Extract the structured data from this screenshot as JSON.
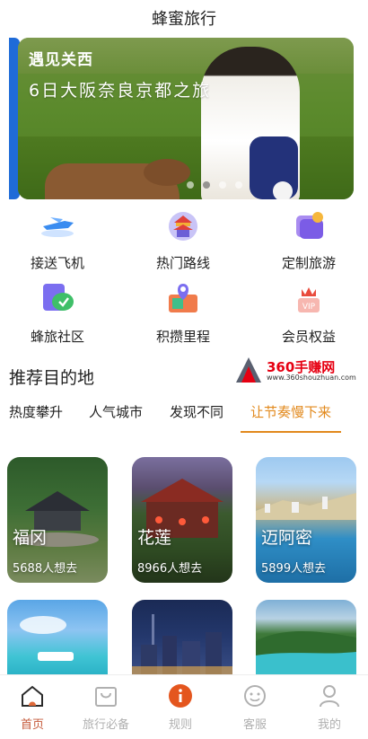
{
  "header": {
    "title": "蜂蜜旅行"
  },
  "banner": {
    "tag": "遇见关西",
    "title": "6日大阪奈良京都之旅"
  },
  "services": [
    {
      "label": "接送飞机",
      "icon": "plane-pickup-icon"
    },
    {
      "label": "热门路线",
      "icon": "temple-route-icon"
    },
    {
      "label": "定制旅游",
      "icon": "custom-tour-icon"
    },
    {
      "label": "蜂旅社区",
      "icon": "community-chat-icon"
    },
    {
      "label": "积攒里程",
      "icon": "mileage-map-icon"
    },
    {
      "label": "会员权益",
      "icon": "vip-crown-icon"
    }
  ],
  "section": {
    "title": "推荐目的地"
  },
  "watermark": {
    "text": "360手赚网",
    "url": "www.360shouzhuan.com"
  },
  "tabs": [
    {
      "label": "热度攀升",
      "active": false
    },
    {
      "label": "人气城市",
      "active": false
    },
    {
      "label": "发现不同",
      "active": false
    },
    {
      "label": "让节奏慢下来",
      "active": true
    }
  ],
  "destinations": [
    {
      "name": "福冈",
      "subtitle": "5688人想去"
    },
    {
      "name": "花莲",
      "subtitle": "8966人想去"
    },
    {
      "name": "迈阿密",
      "subtitle": "5899人想去"
    }
  ],
  "bottom_nav": [
    {
      "label": "首页",
      "icon": "home-icon",
      "active": true
    },
    {
      "label": "旅行必备",
      "icon": "bag-icon",
      "active": false
    },
    {
      "label": "规则",
      "icon": "info-icon",
      "active": false
    },
    {
      "label": "客服",
      "icon": "support-face-icon",
      "active": false
    },
    {
      "label": "我的",
      "icon": "profile-icon",
      "active": false
    }
  ],
  "colors": {
    "accent": "#e2891c",
    "nav_active": "#c55a3b",
    "nav_inactive": "#b0b0b0"
  }
}
